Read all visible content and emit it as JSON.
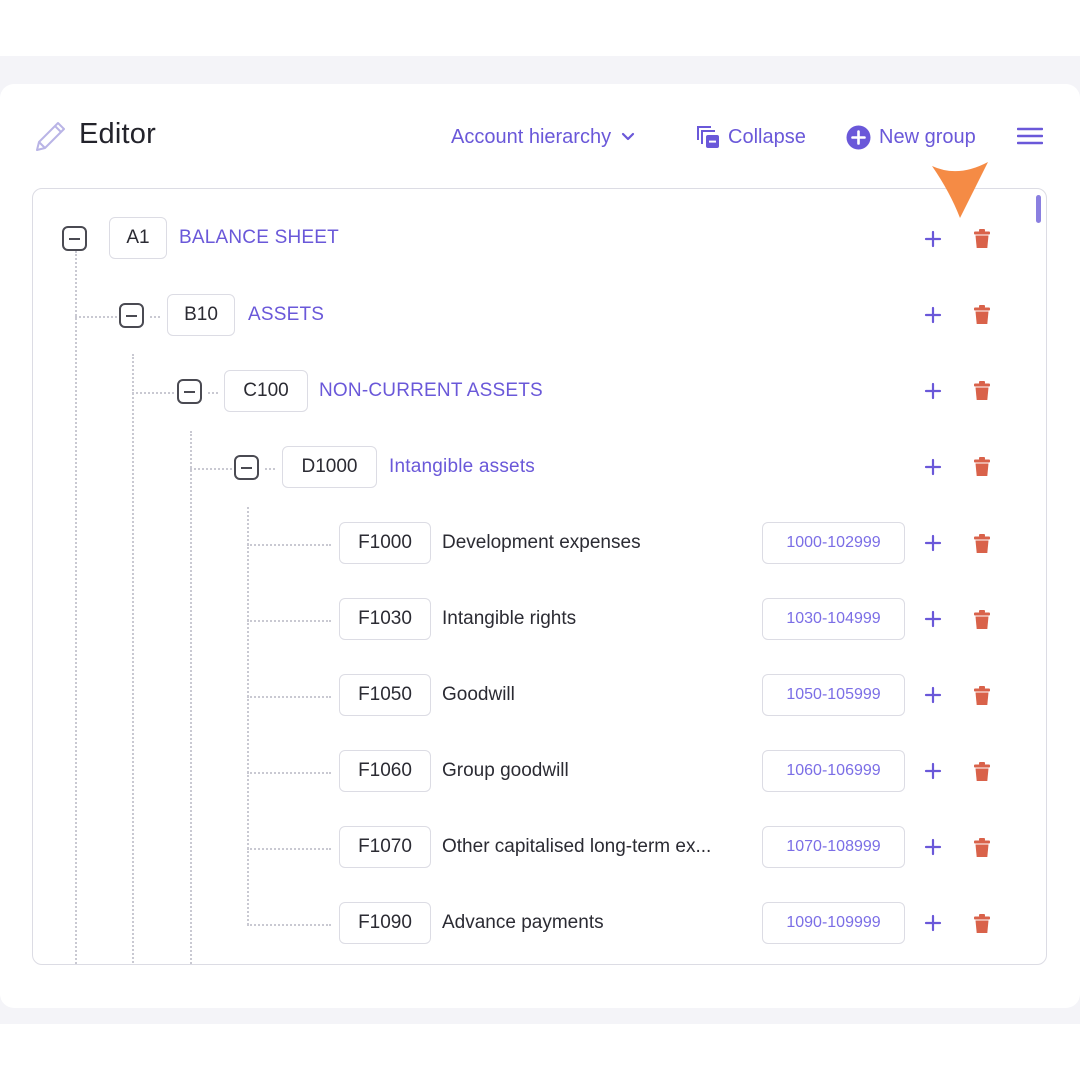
{
  "header": {
    "title": "Editor",
    "hierarchy_label": "Account hierarchy",
    "collapse_label": "Collapse",
    "new_group_label": "New group",
    "icons": {
      "editor": "pencil-icon",
      "hierarchy": "chevron-down-icon",
      "collapse": "collapse-icon",
      "new_group": "plus-circle-icon",
      "menu": "hamburger-menu-icon"
    }
  },
  "colors": {
    "accent": "#6a58d9",
    "delete": "#d9624a",
    "pointer": "#f58b45",
    "border": "#dcdce4"
  },
  "tree": {
    "groups": [
      {
        "code": "A1",
        "label": "BALANCE SHEET",
        "expanded": true
      },
      {
        "code": "B10",
        "label": "ASSETS",
        "expanded": true
      },
      {
        "code": "C100",
        "label": "NON-CURRENT ASSETS",
        "expanded": true
      },
      {
        "code": "D1000",
        "label": "Intangible assets",
        "expanded": true
      }
    ],
    "accounts": [
      {
        "code": "F1000",
        "label": "Development expenses",
        "range": "1000-102999"
      },
      {
        "code": "F1030",
        "label": "Intangible rights",
        "range": "1030-104999"
      },
      {
        "code": "F1050",
        "label": "Goodwill",
        "range": "1050-105999"
      },
      {
        "code": "F1060",
        "label": "Group goodwill",
        "range": "1060-106999"
      },
      {
        "code": "F1070",
        "label": "Other capitalised long-term ex...",
        "range": "1070-108999"
      },
      {
        "code": "F1090",
        "label": "Advance payments",
        "range": "1090-109999"
      }
    ]
  }
}
